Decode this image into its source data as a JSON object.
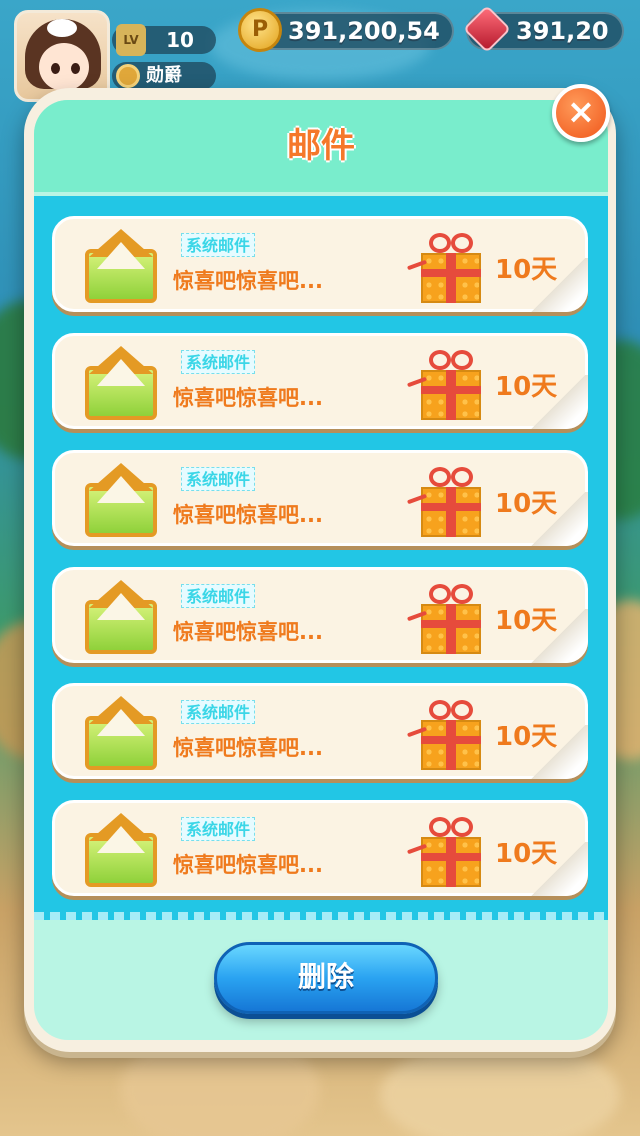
{
  "hud": {
    "level_badge": "LV",
    "level": "10",
    "medal_label": "勋爵",
    "coin_symbol": "P",
    "coins": "391,200,54",
    "gems": "391,20"
  },
  "dialog": {
    "title": "邮件",
    "close_symbol": "×",
    "delete_label": "删除"
  },
  "mails": [
    {
      "tag": "系统邮件",
      "subject": "惊喜吧惊喜吧...",
      "expires": "10天"
    },
    {
      "tag": "系统邮件",
      "subject": "惊喜吧惊喜吧...",
      "expires": "10天"
    },
    {
      "tag": "系统邮件",
      "subject": "惊喜吧惊喜吧...",
      "expires": "10天"
    },
    {
      "tag": "系统邮件",
      "subject": "惊喜吧惊喜吧...",
      "expires": "10天"
    },
    {
      "tag": "系统邮件",
      "subject": "惊喜吧惊喜吧...",
      "expires": "10天"
    },
    {
      "tag": "系统邮件",
      "subject": "惊喜吧惊喜吧...",
      "expires": "10天"
    }
  ],
  "icons": {
    "mail": "envelope-icon",
    "attachment": "gift-box-icon",
    "coin": "coin-icon",
    "gem": "ruby-gem-icon",
    "medal": "medal-icon",
    "close": "close-icon"
  },
  "colors": {
    "title": "#f5782a",
    "list_bg": "#22c6e5",
    "header_bg": "#79edcc",
    "delete_button": "#2aa3f1"
  }
}
